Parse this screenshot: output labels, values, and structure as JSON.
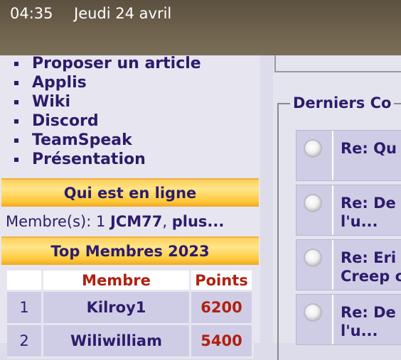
{
  "status_bar": {
    "time": "04:35",
    "date": "Jeudi 24 avril"
  },
  "nav": {
    "items": [
      "Proposer un article",
      "Applis",
      "Wiki",
      "Discord",
      "TeamSpeak",
      "Présentation"
    ]
  },
  "online": {
    "header": "Qui est en ligne",
    "prefix": "Membre(s): 1 ",
    "member": "JCM77",
    "separator": ", ",
    "more": "plus..."
  },
  "top_members": {
    "header": "Top Membres 2023",
    "columns": [
      "Membre",
      "Points"
    ],
    "rows": [
      {
        "rank": "1",
        "name": "Kilroy1",
        "points": "6200"
      },
      {
        "rank": "2",
        "name": "Wiliwilliam",
        "points": "5400"
      }
    ]
  },
  "comments": {
    "legend": "Derniers Co",
    "items": [
      "Re: Qu",
      "Re: De\nl'u...",
      "Re: Eri\nCreep c",
      "Re: De\nl'u..."
    ]
  }
}
